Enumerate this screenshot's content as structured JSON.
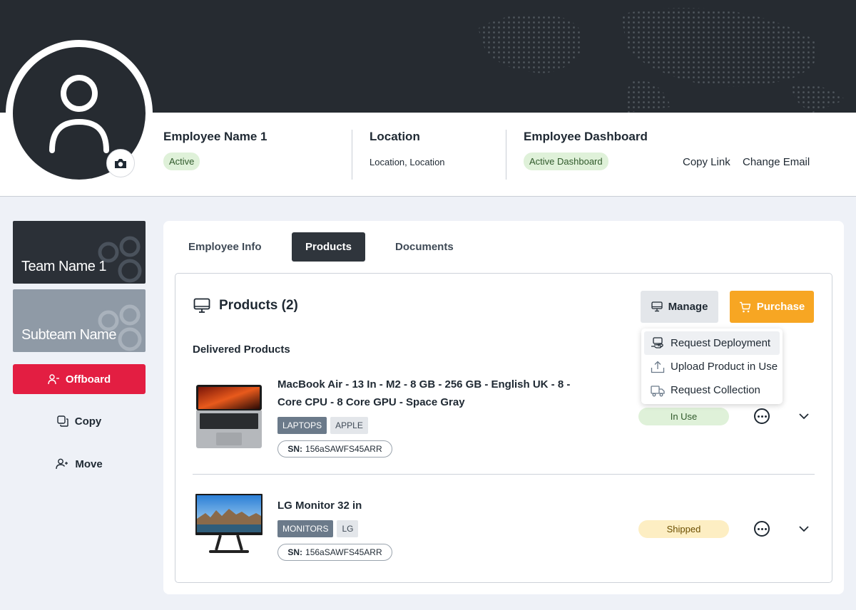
{
  "employee": {
    "name": "Employee Name 1",
    "status": "Active",
    "location_title": "Location",
    "location_value": "Location, Location",
    "dashboard_title": "Employee Dashboard",
    "dashboard_status": "Active Dashboard",
    "copy_link": "Copy Link",
    "change_email": "Change Email"
  },
  "sidebar": {
    "team_name": "Team Name 1",
    "subteam_name": "Subteam Name",
    "offboard_label": "Offboard",
    "copy_label": "Copy",
    "move_label": "Move"
  },
  "tabs": [
    {
      "label": "Employee Info"
    },
    {
      "label": "Products"
    },
    {
      "label": "Documents"
    }
  ],
  "products": {
    "title": "Products (2)",
    "manage_label": "Manage",
    "purchase_label": "Purchase",
    "section_label": "Delivered Products",
    "menu": [
      {
        "label": "Request Deployment",
        "icon": "deploy-icon"
      },
      {
        "label": "Upload Product in Use",
        "icon": "upload-icon"
      },
      {
        "label": "Request Collection",
        "icon": "truck-icon"
      }
    ],
    "items": [
      {
        "name_line1": "MacBook Air - 13 In - M2 - 8 GB - 256 GB - English UK - 8 -",
        "name_line2": "Core CPU - 8 Core GPU - Space Gray",
        "tags": [
          "LAPTOPS",
          "APPLE"
        ],
        "sn_label": "SN:",
        "sn_value": "156aSAWFS45ARR",
        "status": "In Use"
      },
      {
        "name_line1": "LG Monitor 32 in",
        "tags": [
          "MONITORS",
          "LG"
        ],
        "sn_label": "SN:",
        "sn_value": "156aSAWFS45ARR",
        "status": "Shipped"
      }
    ]
  },
  "colors": {
    "banner": "#262b31",
    "offboard": "#e31e42",
    "purchase": "#f7a623",
    "active_tab": "#2f353c",
    "status_green": "#dff1d9",
    "status_yellow": "#fdeec3"
  }
}
